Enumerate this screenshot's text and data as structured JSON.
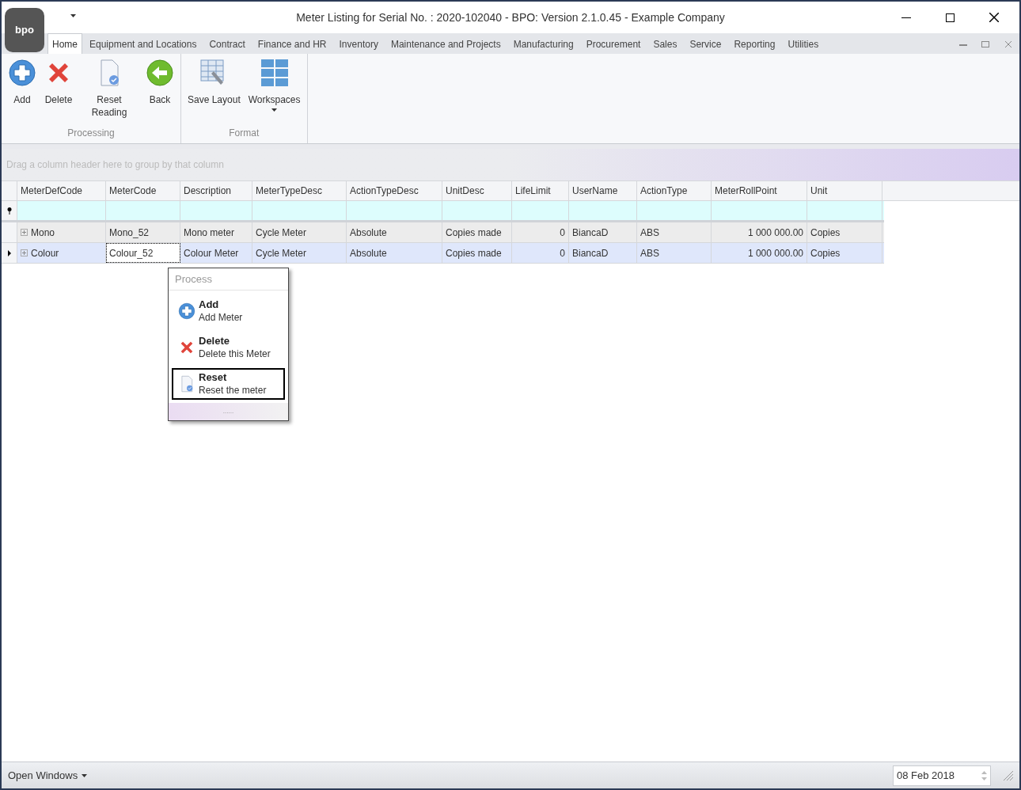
{
  "window": {
    "title": "Meter Listing for Serial No. : 2020-102040 - BPO: Version 2.1.0.45 - Example Company",
    "logo": "bpo"
  },
  "menu_tabs": [
    {
      "label": "Home",
      "selected": true
    },
    {
      "label": "Equipment and Locations",
      "selected": false
    },
    {
      "label": "Contract",
      "selected": false
    },
    {
      "label": "Finance and HR",
      "selected": false
    },
    {
      "label": "Inventory",
      "selected": false
    },
    {
      "label": "Maintenance and Projects",
      "selected": false
    },
    {
      "label": "Manufacturing",
      "selected": false
    },
    {
      "label": "Procurement",
      "selected": false
    },
    {
      "label": "Sales",
      "selected": false
    },
    {
      "label": "Service",
      "selected": false
    },
    {
      "label": "Reporting",
      "selected": false
    },
    {
      "label": "Utilities",
      "selected": false
    }
  ],
  "ribbon_groups": [
    {
      "label": "Processing",
      "buttons": [
        {
          "kind": "add",
          "label": "Add"
        },
        {
          "kind": "delete",
          "label": "Delete"
        },
        {
          "kind": "reset",
          "label": "Reset Reading"
        },
        {
          "kind": "back",
          "label": "Back"
        }
      ]
    },
    {
      "label": "Format",
      "buttons": [
        {
          "kind": "layout",
          "label": "Save Layout"
        },
        {
          "kind": "workspaces",
          "label": "Workspaces"
        }
      ]
    }
  ],
  "group_panel": {
    "placeholder": "Drag a column header here to group by that column"
  },
  "table": {
    "columns": [
      {
        "label": "MeterDefCode"
      },
      {
        "label": "MeterCode"
      },
      {
        "label": "Description"
      },
      {
        "label": "MeterTypeDesc"
      },
      {
        "label": "ActionTypeDesc"
      },
      {
        "label": "UnitDesc"
      },
      {
        "label": "LifeLimit"
      },
      {
        "label": "UserName"
      },
      {
        "label": "ActionType"
      },
      {
        "label": "MeterRollPoint"
      },
      {
        "label": "Unit"
      }
    ],
    "rows": [
      {
        "selected": false,
        "cells": [
          {
            "text": "Mono",
            "focused": false
          },
          {
            "text": "Mono_52",
            "focused": false
          },
          {
            "text": "Mono meter",
            "focused": false
          },
          {
            "text": "Cycle Meter",
            "focused": false
          },
          {
            "text": "Absolute",
            "focused": false
          },
          {
            "text": "Copies made",
            "focused": false
          },
          {
            "text": "0",
            "focused": false
          },
          {
            "text": "BiancaD",
            "focused": false
          },
          {
            "text": "ABS",
            "focused": false
          },
          {
            "text": "1 000 000.00",
            "focused": false
          },
          {
            "text": "Copies",
            "focused": false
          }
        ]
      },
      {
        "selected": true,
        "cells": [
          {
            "text": "Colour",
            "focused": false
          },
          {
            "text": "Colour_52",
            "focused": true
          },
          {
            "text": "Colour Meter",
            "focused": false
          },
          {
            "text": "Cycle Meter",
            "focused": false
          },
          {
            "text": "Absolute",
            "focused": false
          },
          {
            "text": "Copies made",
            "focused": false
          },
          {
            "text": "0",
            "focused": false
          },
          {
            "text": "BiancaD",
            "focused": false
          },
          {
            "text": "ABS",
            "focused": false
          },
          {
            "text": "1 000 000.00",
            "focused": false
          },
          {
            "text": "Copies",
            "focused": false
          }
        ]
      }
    ]
  },
  "context_menu": {
    "header": "Process",
    "items": [
      {
        "kind": "add",
        "title": "Add",
        "subtitle": "Add Meter",
        "selected": false
      },
      {
        "kind": "delete",
        "title": "Delete",
        "subtitle": "Delete this Meter",
        "selected": false
      },
      {
        "kind": "reset",
        "title": "Reset",
        "subtitle": "Reset the meter",
        "selected": true
      }
    ],
    "grip": "......"
  },
  "status_bar": {
    "open_windows": "Open Windows",
    "date": "08 Feb 2018"
  }
}
